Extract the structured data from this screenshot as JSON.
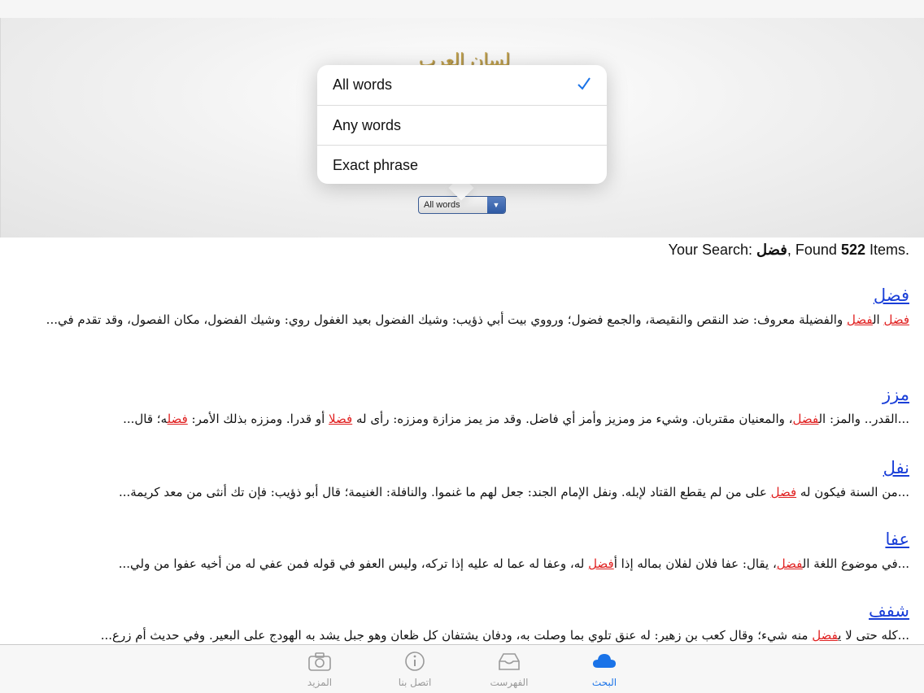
{
  "header": {
    "logo_text": "لسان العرب"
  },
  "search_mode": {
    "selected": "All words",
    "options": [
      {
        "label": "All words",
        "checked": true
      },
      {
        "label": "Any words",
        "checked": false
      },
      {
        "label": "Exact phrase",
        "checked": false
      }
    ]
  },
  "summary": {
    "prefix": "Your Search: ",
    "term": "فضل",
    "middle": ", Found ",
    "count": "522",
    "suffix": " Items."
  },
  "results": [
    {
      "title": "فضل",
      "snippet_parts": [
        {
          "t": "فضل",
          "hl": true
        },
        {
          "t": " ال",
          "hl": false
        },
        {
          "t": "فضل",
          "hl": true
        },
        {
          "t": " والفضيلة معروف: ضد النقص والنقيصة، والجمع فضول؛ ورووي بيت أبي ذؤيب: وشيك الفضول بعيد الغفول روي: وشيك الفضول، مكان الفصول، وقد تقدم في...",
          "hl": false
        }
      ]
    },
    {
      "title": "مزز",
      "snippet_parts": [
        {
          "t": "...القدر.. والمز: ال",
          "hl": false
        },
        {
          "t": "فضل",
          "hl": true
        },
        {
          "t": "، والمعنيان مقتربان. وشيء مز ومزيز وأمز أي فاضل. وقد مز يمز مزازة ومززه: رأى له ",
          "hl": false
        },
        {
          "t": "فضل",
          "hl": true
        },
        {
          "t": "ا أو قدرا. ومززه بذلك الأمر: ",
          "hl": false
        },
        {
          "t": "فضل",
          "hl": true
        },
        {
          "t": "ه؛ قال...",
          "hl": false
        }
      ]
    },
    {
      "title": "نفل",
      "snippet_parts": [
        {
          "t": "...من السنة فيكون له ",
          "hl": false
        },
        {
          "t": "فضل",
          "hl": true
        },
        {
          "t": " على من لم يقطع القتاد لإبله. ونفل الإمام الجند: جعل لهم ما غنموا. والنافلة: الغنيمة؛ قال أبو ذؤيب: فإن تك أنثى من معد كريمة...",
          "hl": false
        }
      ]
    },
    {
      "title": "عفا",
      "snippet_parts": [
        {
          "t": "...في موضوع اللغة ال",
          "hl": false
        },
        {
          "t": "فضل",
          "hl": true
        },
        {
          "t": "، يقال: عفا فلان لفلان بماله إذا أ",
          "hl": false
        },
        {
          "t": "فضل",
          "hl": true
        },
        {
          "t": " له، وعفا له عما له عليه إذا تركه، وليس العفو في قوله فمن عفي له من أخيه عفوا من ولي...",
          "hl": false
        }
      ]
    },
    {
      "title": "شفف",
      "snippet_parts": [
        {
          "t": "...كله حتى لا ي",
          "hl": false
        },
        {
          "t": "فضل",
          "hl": true
        },
        {
          "t": " منه شيء؛ وقال كعب بن زهير: له عنق تلوي بما وصلت به، ودفان يشتفان كل ظعان وهو جبل يشد به الهودج على البعير. وفي حديث أم زرع...",
          "hl": false
        }
      ]
    }
  ],
  "tabs": [
    {
      "label": "المزيد",
      "icon": "camera-icon"
    },
    {
      "label": "اتصل بنا",
      "icon": "info-icon"
    },
    {
      "label": "الفهرست",
      "icon": "inbox-icon"
    },
    {
      "label": "البحث",
      "icon": "cloud-icon",
      "active": true
    }
  ],
  "colors": {
    "link": "#1a3fd8",
    "highlight": "#e02020",
    "tab_active": "#1a73e8",
    "check": "#1a73e8"
  }
}
